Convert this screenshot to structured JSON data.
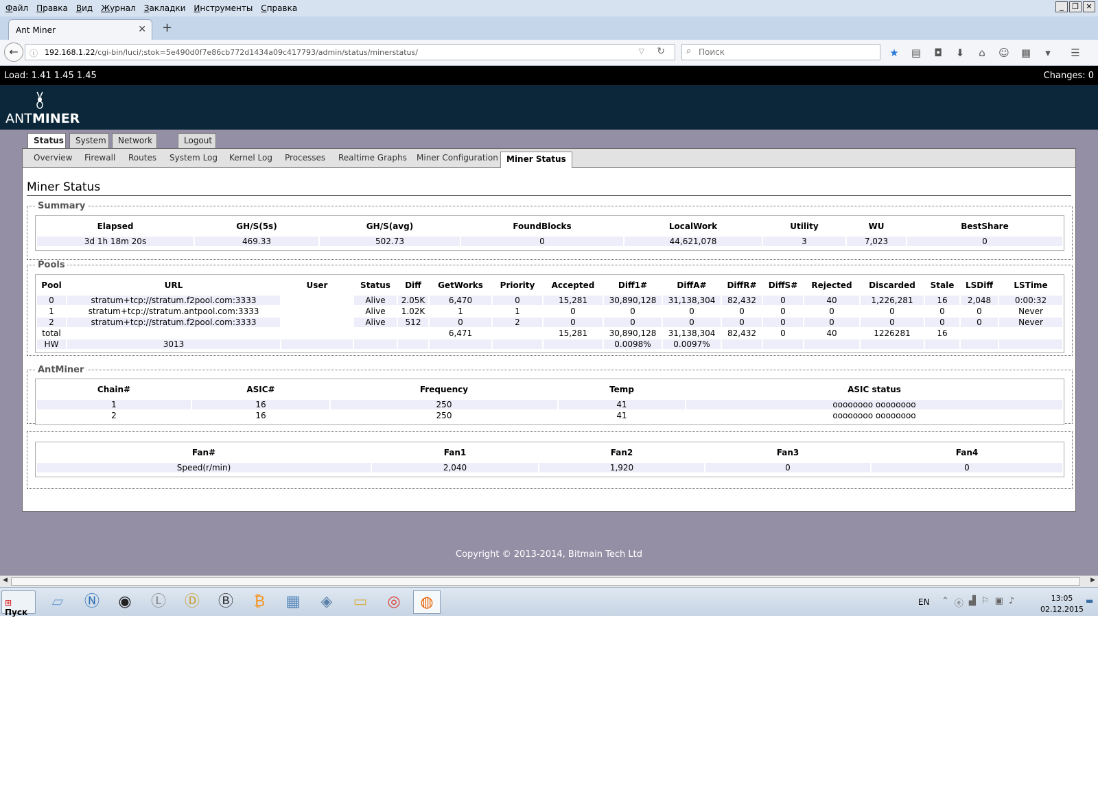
{
  "browser": {
    "menu": [
      "Файл",
      "Правка",
      "Вид",
      "Журнал",
      "Закладки",
      "Инструменты",
      "Справка"
    ],
    "tab_title": "Ant Miner",
    "url_host": "192.168.1.22",
    "url_path": "/cgi-bin/luci/;stok=5e490d0f7e86cb772d1434a09c417793/admin/status/minerstatus/",
    "search_placeholder": "Поиск"
  },
  "luci": {
    "load": "Load: 1.41 1.45 1.45",
    "changes": "Changes: 0",
    "logo_left": "ANT",
    "logo_right": "MINER",
    "top_tabs": [
      "Status",
      "System",
      "Network",
      "Logout"
    ],
    "sub_tabs": [
      "Overview",
      "Firewall",
      "Routes",
      "System Log",
      "Kernel Log",
      "Processes",
      "Realtime Graphs",
      "Miner Configuration",
      "Miner Status"
    ],
    "page_title": "Miner Status",
    "footer": "Copyright © 2013-2014, Bitmain Tech Ltd"
  },
  "summary": {
    "legend": "Summary",
    "headers": [
      "Elapsed",
      "GH/S(5s)",
      "GH/S(avg)",
      "FoundBlocks",
      "LocalWork",
      "Utility",
      "WU",
      "BestShare"
    ],
    "row": [
      "3d 1h 18m 20s",
      "469.33",
      "502.73",
      "0",
      "44,621,078",
      "3",
      "7,023",
      "0"
    ]
  },
  "pools": {
    "legend": "Pools",
    "headers": [
      "Pool",
      "URL",
      "User",
      "Status",
      "Diff",
      "GetWorks",
      "Priority",
      "Accepted",
      "Diff1#",
      "DiffA#",
      "DiffR#",
      "DiffS#",
      "Rejected",
      "Discarded",
      "Stale",
      "LSDiff",
      "LSTime"
    ],
    "rows": [
      [
        "0",
        "stratum+tcp://stratum.f2pool.com:3333",
        "",
        "Alive",
        "2.05K",
        "6,470",
        "0",
        "15,281",
        "30,890,128",
        "31,138,304",
        "82,432",
        "0",
        "40",
        "1,226,281",
        "16",
        "2,048",
        "0:00:32"
      ],
      [
        "1",
        "stratum+tcp://stratum.antpool.com:3333",
        "",
        "Alive",
        "1.02K",
        "1",
        "1",
        "0",
        "0",
        "0",
        "0",
        "0",
        "0",
        "0",
        "0",
        "0",
        "Never"
      ],
      [
        "2",
        "stratum+tcp://stratum.f2pool.com:3333",
        "",
        "Alive",
        "512",
        "0",
        "2",
        "0",
        "0",
        "0",
        "0",
        "0",
        "0",
        "0",
        "0",
        "0",
        "Never"
      ],
      [
        "total",
        "",
        "",
        "",
        "",
        "6,471",
        "",
        "15,281",
        "30,890,128",
        "31,138,304",
        "82,432",
        "0",
        "40",
        "1226281",
        "16",
        "",
        ""
      ],
      [
        "HW",
        "3013",
        "",
        "",
        "",
        "",
        "",
        "",
        "0.0098%",
        "0.0097%",
        "",
        "",
        "",
        "",
        "",
        "",
        ""
      ]
    ]
  },
  "antminer": {
    "legend": "AntMiner",
    "headers": [
      "Chain#",
      "ASIC#",
      "Frequency",
      "Temp",
      "ASIC status"
    ],
    "rows": [
      [
        "1",
        "16",
        "250",
        "41",
        "oooooooo oooooooo"
      ],
      [
        "2",
        "16",
        "250",
        "41",
        "oooooooo oooooooo"
      ]
    ]
  },
  "fans": {
    "headers": [
      "Fan#",
      "Fan1",
      "Fan2",
      "Fan3",
      "Fan4"
    ],
    "row": [
      "Speed(r/min)",
      "2,040",
      "1,920",
      "0",
      "0"
    ]
  },
  "taskbar": {
    "start_label": "Пуск",
    "lang": "EN",
    "time": "13:05",
    "date": "02.12.2015"
  }
}
